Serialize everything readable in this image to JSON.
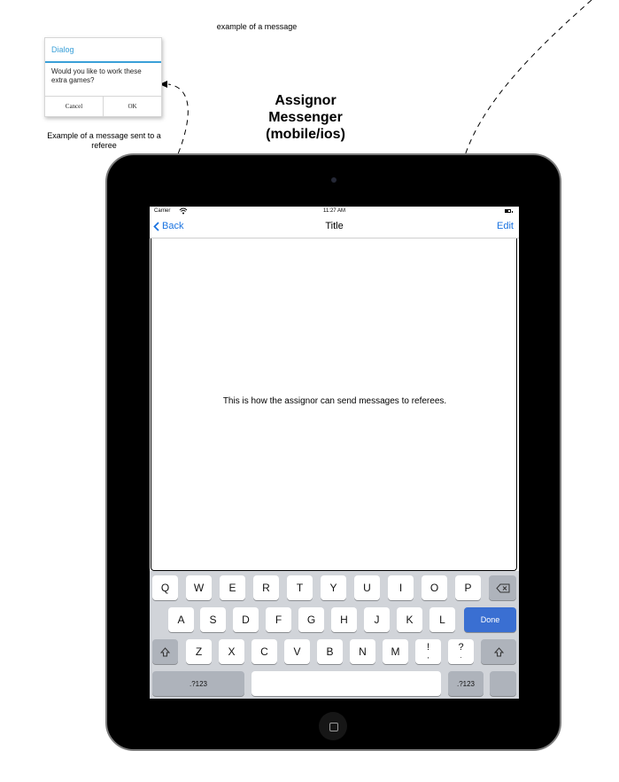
{
  "annotations": {
    "example_label": "example of a message",
    "title_lines": [
      "Assignor",
      "Messenger",
      "(mobile/ios)"
    ],
    "sent_caption": "Example of a message sent to a referee"
  },
  "dialog": {
    "title": "Dialog",
    "text": "Would you like to work these extra games?",
    "cancel": "Cancel",
    "ok": "OK",
    "accent_color": "#3aa0d8"
  },
  "status_bar": {
    "carrier": "Carrier",
    "time": "11:27 AM",
    "wifi_icon": "wifi-icon",
    "battery_icon": "battery-icon"
  },
  "nav": {
    "back": "Back",
    "title": "Title",
    "edit": "Edit",
    "link_color": "#1a73e0"
  },
  "content": {
    "text": "This is how the assignor can send messages to referees."
  },
  "keyboard": {
    "row1": [
      "Q",
      "W",
      "E",
      "R",
      "T",
      "Y",
      "U",
      "I",
      "O",
      "P"
    ],
    "row2": [
      "A",
      "S",
      "D",
      "F",
      "G",
      "H",
      "J",
      "K",
      "L"
    ],
    "row3": [
      "Z",
      "X",
      "C",
      "V",
      "B",
      "N",
      "M"
    ],
    "punct": [
      {
        "top": "!",
        "bottom": ","
      },
      {
        "top": "?",
        "bottom": "."
      }
    ],
    "done": "Done",
    "numbers": ".?123",
    "done_color": "#3a6fd2"
  }
}
